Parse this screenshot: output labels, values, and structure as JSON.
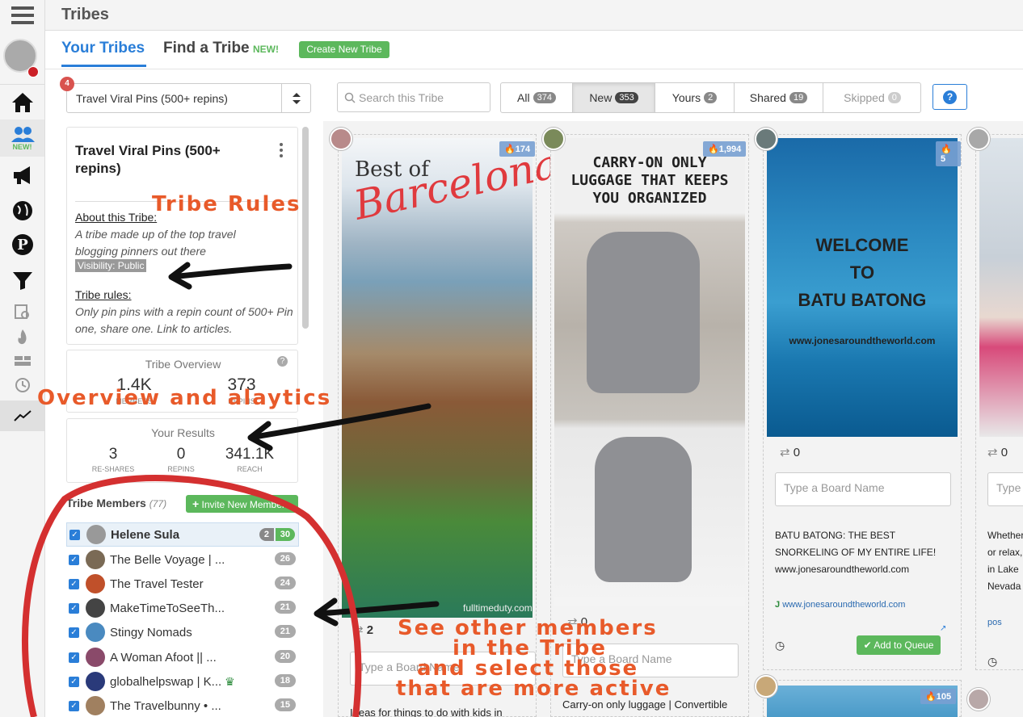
{
  "app": {
    "title": "Tribes",
    "menu_icon": "hamburger-icon"
  },
  "tabs": {
    "your": "Your Tribes",
    "find": "Find a Tribe",
    "find_badge": "NEW!",
    "create": "Create New Tribe"
  },
  "sidebar": {
    "new_label": "NEW!",
    "notif_count": "4"
  },
  "tribe_select": {
    "value": "Travel Viral Pins (500+ repins)"
  },
  "search": {
    "placeholder": "Search this Tribe"
  },
  "filters": [
    {
      "label": "All",
      "count": "374"
    },
    {
      "label": "New",
      "count": "353"
    },
    {
      "label": "Yours",
      "count": "2"
    },
    {
      "label": "Shared",
      "count": "19"
    },
    {
      "label": "Skipped",
      "count": "0"
    }
  ],
  "help": "?",
  "info": {
    "title": "Travel Viral Pins (500+ repins)",
    "about_label": "About this Tribe:",
    "about_text": "A tribe made up of the top travel blogging pinners out there",
    "visibility": "Visibility: Public",
    "rules_label": "Tribe rules:",
    "rules_text": "Only pin pins with a repin count of 500+ Pin one, share one. Link to articles."
  },
  "overview": {
    "title": "Tribe Overview",
    "members": "1.4K",
    "members_label": "MEMBERS",
    "repins": "373",
    "repins_label": "REPINS"
  },
  "results": {
    "title": "Your Results",
    "reshares": "3",
    "reshares_label": "RE-SHARES",
    "repins": "0",
    "repins_label": "REPINS",
    "reach": "341.1K",
    "reach_label": "REACH"
  },
  "members": {
    "title": "Tribe Members",
    "count": "(77)",
    "invite": "Invite New Member",
    "list": [
      {
        "name": "Helene Sula",
        "badge": "2",
        "count": "30",
        "bold": true,
        "color": "#999"
      },
      {
        "name": "The Belle Voyage | ...",
        "count": "26",
        "color": "#7a6a55"
      },
      {
        "name": "The Travel Tester",
        "count": "24",
        "color": "#c0502a"
      },
      {
        "name": "MakeTimeToSeeTh...",
        "count": "21",
        "color": "#444"
      },
      {
        "name": "Stingy Nomads",
        "count": "21",
        "color": "#4a8ac0"
      },
      {
        "name": "A Woman Afoot || ...",
        "count": "20",
        "color": "#8a4a6a"
      },
      {
        "name": "globalhelpswap | K...",
        "count": "18",
        "color": "#2a3a7a"
      },
      {
        "name": "The Travelbunny • ...",
        "count": "15",
        "color": "#a08060"
      }
    ]
  },
  "pins": [
    {
      "fire": "174",
      "img_text1": "Best of",
      "img_text2": "Barcelona",
      "watermark": "fulltimeduty.com",
      "reshares": "2",
      "board_placeholder": "Type a Board Name",
      "desc": "Ideas for things to do with kids in"
    },
    {
      "fire": "1,994",
      "img_text": "CARRY-ON ONLY LUGGAGE THAT KEEPS YOU ORGANIZED",
      "reshares": "0",
      "board_placeholder": "Type a Board Name",
      "desc": "Carry-on only luggage | Convertible"
    },
    {
      "fire": "5",
      "img_text1": "WELCOME",
      "img_text2": "TO",
      "img_text3": "BATU BATONG",
      "img_text4": "www.jonesaroundtheworld.com",
      "reshares": "0",
      "board_placeholder": "Type a Board Name",
      "desc": "BATU BATONG: THE BEST SNORKELING OF MY ENTIRE LIFE! www.jonesaroundtheworld.com",
      "link": "www.jonesaroundtheworld.com",
      "add_queue": "Add to Queue",
      "fire2": "105"
    },
    {
      "reshares": "0",
      "board_placeholder": "Type",
      "desc": "Whether or relax, in Lake Nevada",
      "link": "pos"
    }
  ],
  "annotations": {
    "rules": "Tribe Rules",
    "overview": "Overview and alaytics",
    "members1": "See other members",
    "members2": "in the Tribe",
    "members3": "and select those",
    "members4": "that are more active"
  }
}
